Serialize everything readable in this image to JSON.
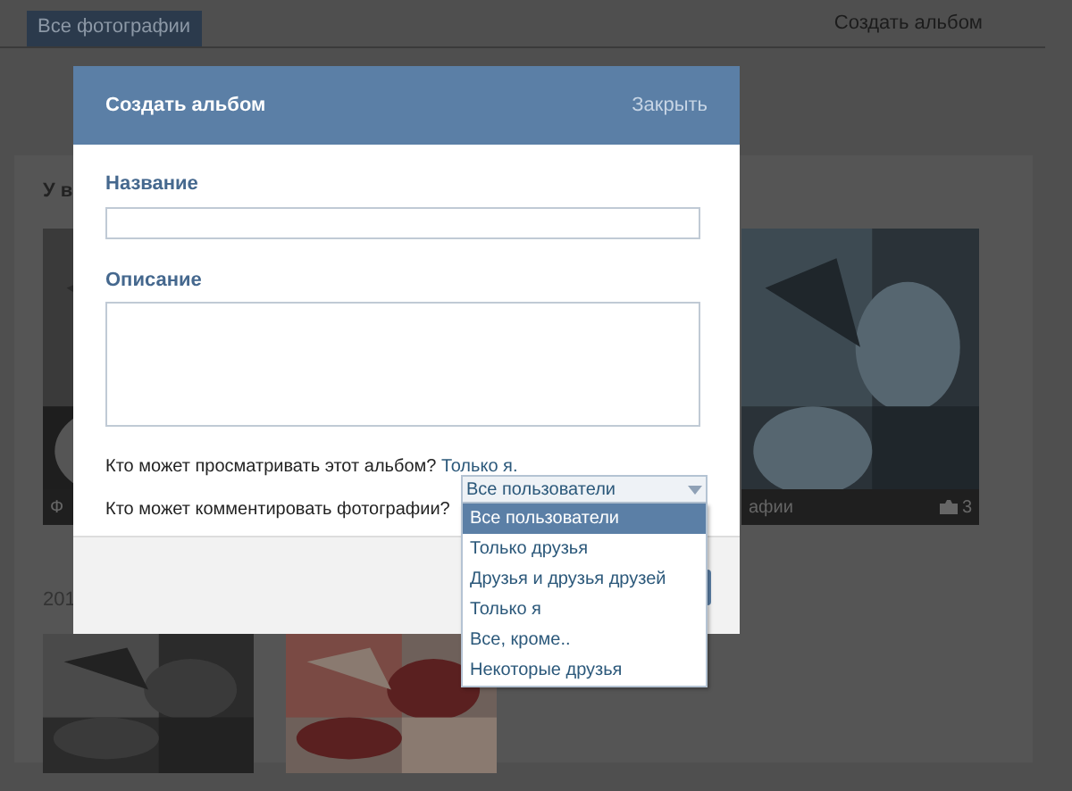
{
  "page": {
    "tabs": [
      {
        "label": "Все фотографии",
        "selected": true
      }
    ],
    "create_album_link": "Создать альбом",
    "section_title": "У в",
    "albums": [
      {
        "caption": "Ф"
      },
      {
        "caption": "афии",
        "count": "3"
      }
    ],
    "year_label": "201"
  },
  "dialog": {
    "title": "Создать альбом",
    "close": "Закрыть",
    "name_label": "Название",
    "description_label": "Описание",
    "view_question": "Кто может просматривать этот альбом?",
    "view_value": "Только я.",
    "comment_question": "Кто может комментировать фотографии?",
    "comment_select": {
      "value": "Все пользователи",
      "expanded": true,
      "options": [
        {
          "label": "Все пользователи",
          "selected": true
        },
        {
          "label": "Только друзья",
          "selected": false
        },
        {
          "label": "Друзья и друзья друзей",
          "selected": false
        },
        {
          "label": "Только я",
          "selected": false
        },
        {
          "label": "Все, кроме..",
          "selected": false
        },
        {
          "label": "Некоторые друзья",
          "selected": false
        }
      ]
    }
  }
}
